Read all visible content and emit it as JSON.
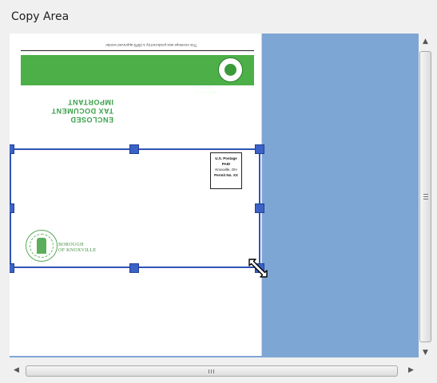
{
  "panel": {
    "title": "Copy Area"
  },
  "document": {
    "strip_text": "This envelope was produced by a USPS-approved vendor",
    "green_bar_text": "BOROUGH OF KNOXVILLE",
    "notice_lines": [
      "IMPORTANT",
      "TAX DOCUMENT",
      "ENCLOSED"
    ],
    "stamp": {
      "line1": "U.S. Postage",
      "line2": "PAID",
      "line3": "Knoxville, OH",
      "line4": "Permit No. XX"
    },
    "borough_line1": "BOROUGH",
    "borough_line2": "OF KNOXVILLE"
  },
  "colors": {
    "canvas_bg": "#7ea6d4",
    "selection": "#2e54b8",
    "green": "#4caf47"
  },
  "icons": {
    "vscroll_up": "triangle-up",
    "vscroll_down": "triangle-down",
    "hscroll_left": "triangle-left",
    "hscroll_right": "triangle-right",
    "resize_cursor": "diagonal-resize-arrow"
  }
}
